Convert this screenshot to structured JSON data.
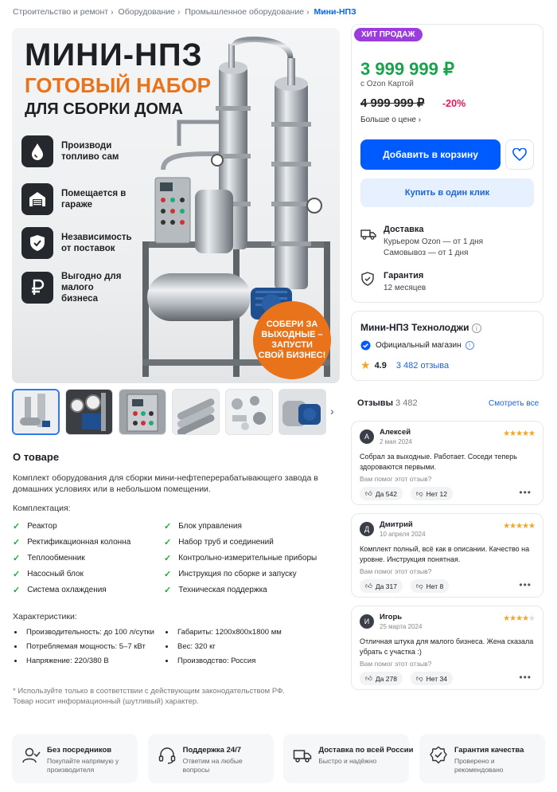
{
  "breadcrumbs": [
    "Строительство и ремонт",
    "Оборудование",
    "Промышленное оборудование",
    "Мини-НПЗ"
  ],
  "hero": {
    "title": "МИНИ-НПЗ",
    "subtitle": "ГОТОВЫЙ НАБОР",
    "subtitle2": "ДЛЯ СБОРКИ ДОМА",
    "features": [
      {
        "icon": "drop-icon",
        "text": "Производи топливо сам"
      },
      {
        "icon": "garage-icon",
        "text": "Помещается в гараже"
      },
      {
        "icon": "shield-check-icon",
        "text": "Независимость от поставок"
      },
      {
        "icon": "ruble-icon",
        "text": "Выгодно для малого бизнеса"
      }
    ],
    "badge": "СОБЕРИ ЗА ВЫХОДНЫЕ – ЗАПУСТИ СВОЙ БИЗНЕС!"
  },
  "about": {
    "title": "О товаре",
    "description": "Комплект оборудования для сборки мини-нефтеперерабатывающего завода в домашних условиях или в небольшом помещении.",
    "kit_title": "Комплектация:",
    "kit_left": [
      "Реактор",
      "Ректификационная колонна",
      "Теплообменник",
      "Насосный блок",
      "Система охлаждения"
    ],
    "kit_right": [
      "Блок управления",
      "Набор труб и соединений",
      "Контрольно-измерительные приборы",
      "Инструкция по сборке и запуску",
      "Техническая поддержка"
    ],
    "spec_title": "Характеристики:",
    "spec_left": [
      "Производительность: до 100 л/сутки",
      "Потребляемая мощность: 5–7 кВт",
      "Напряжение: 220/380 В"
    ],
    "spec_right": [
      "Габариты: 1200x800x1800 мм",
      "Вес: 320 кг",
      "Производство: Россия"
    ],
    "note1": "* Используйте только в соответствии с действующим законодательством РФ.",
    "note2": "Товар носит информационный (шутливый) характер."
  },
  "buy": {
    "badge": "ХИТ ПРОДАЖ",
    "price": "3 999 999 ₽",
    "price_note": "с Ozon Картой",
    "old_price": "4 999 999 ₽",
    "discount": "-20%",
    "more": "Больше о цене ›",
    "cart": "Добавить в корзину",
    "one_click": "Купить в один клик",
    "delivery_title": "Доставка",
    "delivery_1": "Курьером Ozon — от 1 дня",
    "delivery_2": "Самовывоз — от 1 дня",
    "warranty_title": "Гарантия",
    "warranty_value": "12 месяцев"
  },
  "store": {
    "name": "Мини-НПЗ Технолоджи",
    "official": "Официальный магазин",
    "rating": "4.9",
    "reviews": "3 482 отзыва"
  },
  "reviews": {
    "title": "Отзывы",
    "count": "3 482",
    "all": "Смотреть все",
    "helpful": "Вам помог этот отзыв?",
    "items": [
      {
        "initial": "А",
        "name": "Алексей",
        "date": "2 мая 2024",
        "stars": 5,
        "text": "Собрал за выходные. Работает. Соседи теперь здороваются первыми.",
        "yes": "Да 542",
        "no": "Нет 12"
      },
      {
        "initial": "Д",
        "name": "Дмитрий",
        "date": "10 апреля 2024",
        "stars": 5,
        "text": "Комплект полный, всё как в описании. Качество на уровне. Инструкция понятная.",
        "yes": "Да 317",
        "no": "Нет 8"
      },
      {
        "initial": "И",
        "name": "Игорь",
        "date": "25 марта 2024",
        "stars": 3.5,
        "text": "Отличная штука для малого бизнеса. Жена сказала убрать с участка :)",
        "yes": "Да 278",
        "no": "Нет 34"
      }
    ]
  },
  "benefits": [
    {
      "icon": "user-icon",
      "title": "Без посредников",
      "text": "Покупайте напрямую у производителя"
    },
    {
      "icon": "headset-icon",
      "title": "Поддержка 24/7",
      "text": "Ответим на любые вопросы"
    },
    {
      "icon": "truck-icon",
      "title": "Доставка по всей России",
      "text": "Быстро и надёжно"
    },
    {
      "icon": "quality-badge-icon",
      "title": "Гарантия качества",
      "text": "Проверено и рекомендовано"
    }
  ],
  "colors": {
    "accent": "#005bff",
    "price": "#16a34a",
    "discount": "#e0195b",
    "hit": "#9b3ddc",
    "orange": "#e8731a"
  }
}
